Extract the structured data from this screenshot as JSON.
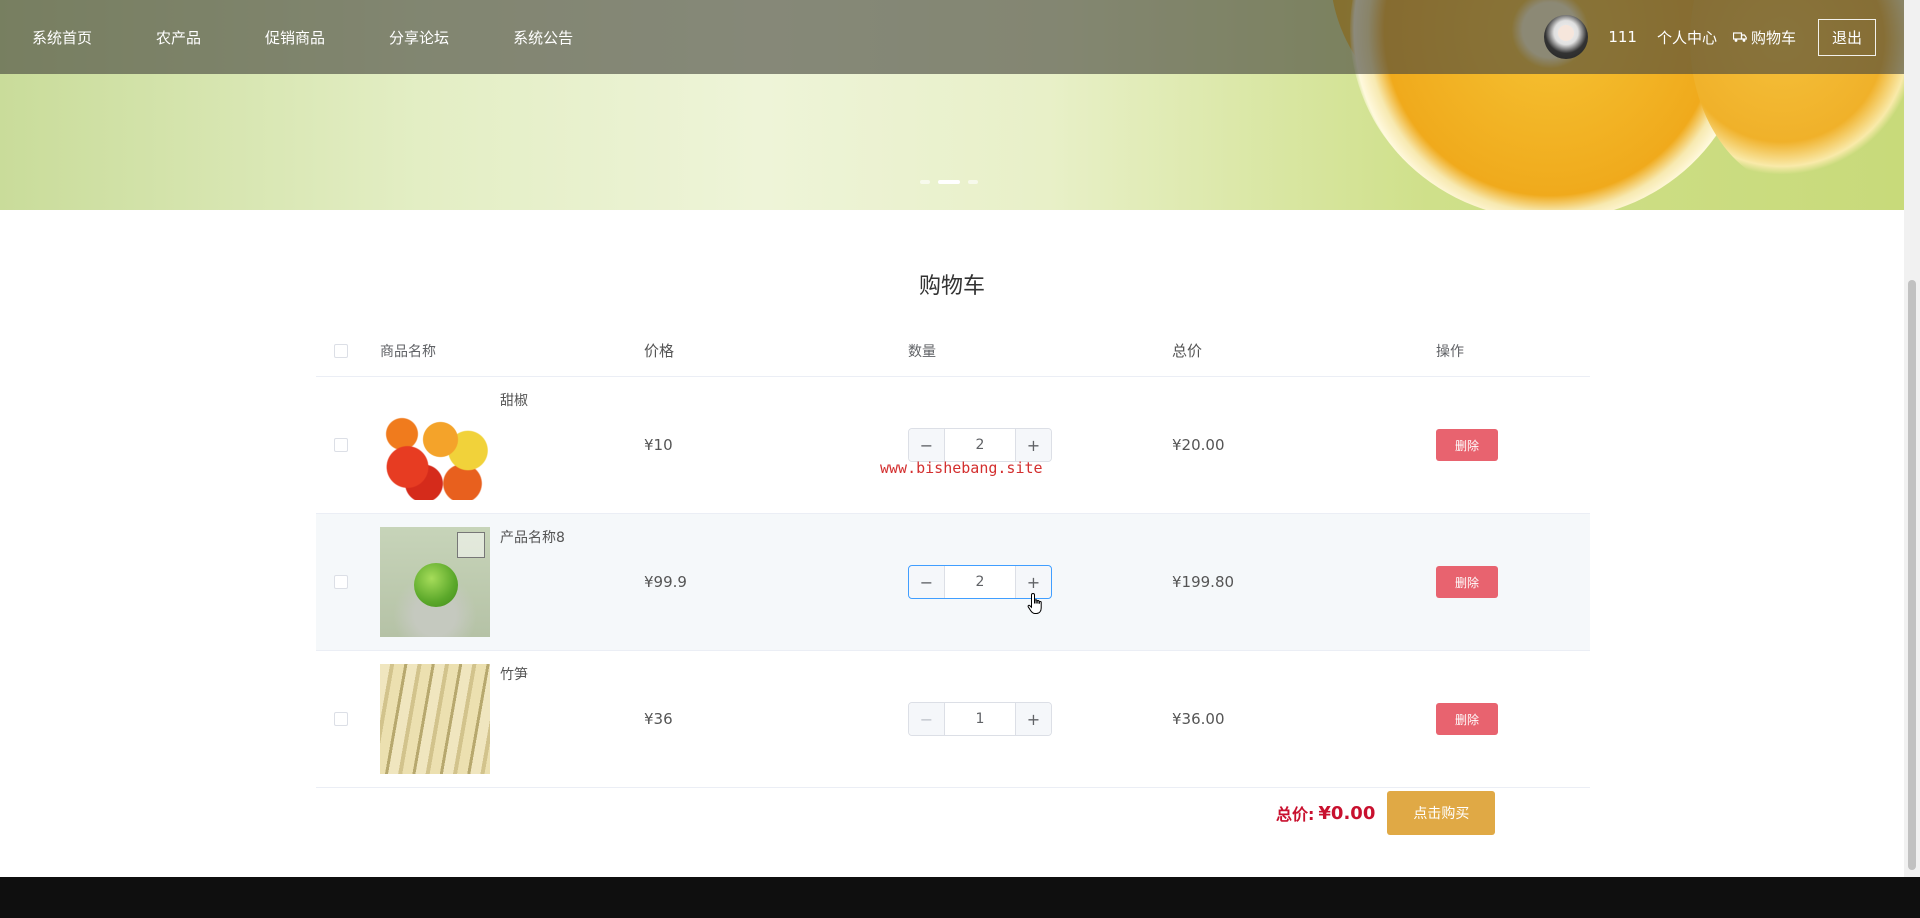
{
  "nav": {
    "links": [
      "系统首页",
      "农产品",
      "促销商品",
      "分享论坛",
      "系统公告"
    ],
    "username": "111",
    "profile_label": "个人中心",
    "cart_label": "购物车",
    "logout_label": "退出"
  },
  "cart": {
    "title": "购物车",
    "headers": {
      "name": "商品名称",
      "price": "价格",
      "qty": "数量",
      "total": "总价",
      "ops": "操作"
    },
    "items": [
      {
        "name": "甜椒",
        "price": "¥10",
        "qty": "2",
        "total": "¥20.00",
        "delete": "删除"
      },
      {
        "name": "产品名称8",
        "price": "¥99.9",
        "qty": "2",
        "total": "¥199.80",
        "delete": "删除"
      },
      {
        "name": "竹笋",
        "price": "¥36",
        "qty": "1",
        "total": "¥36.00",
        "delete": "删除"
      }
    ],
    "total_label": "总价:",
    "total_value": "¥0.00",
    "buy_label": "点击购买"
  },
  "watermark": "www.bishebang.site",
  "colors": {
    "delete": "#e8636f",
    "buy": "#e0a945",
    "total": "#c8102e",
    "watermark": "#d32f2f"
  },
  "icons": {
    "cart": "truck-icon",
    "minus": "minus-icon",
    "plus": "plus-icon"
  }
}
